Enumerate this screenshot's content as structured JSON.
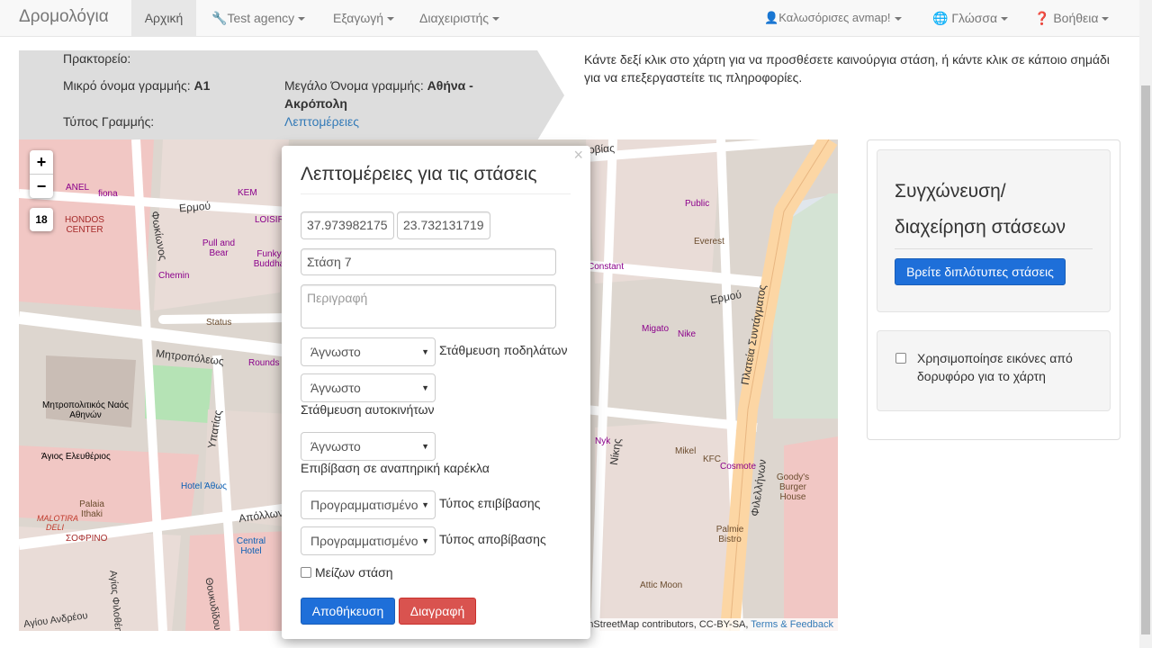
{
  "navbar": {
    "brand": "Δρομολόγια",
    "home": "Αρχική",
    "agency": "Test agency",
    "export": "Εξαγωγή",
    "admin": "Διαχειριστής",
    "user": "Καλωσόρισες avmap!",
    "language": "Γλώσσα",
    "help": "Βοήθεια"
  },
  "route_info": {
    "agency_label": "Πρακτορείο:",
    "short_name_label": "Μικρό όνομα γραμμής:",
    "short_name_value": "A1",
    "long_name_label": "Μεγάλο Όνομα γραμμής:",
    "long_name_value_1": "Αθήνα -",
    "long_name_value_2": "Ακρόπολη",
    "type_label": "Τύπος Γραμμής:",
    "details_link": "Λεπτομέρειες"
  },
  "hint": {
    "line1": "Κάντε δεξί κλικ στο χάρτη για να προσθέσετε καινούργια στάση, ή κάντε κλικ σε κάποιο σημάδι",
    "line2": "για να επεξεργαστείτε τις πληροφορίες."
  },
  "map": {
    "zoom_in": "+",
    "zoom_out": "−",
    "zoom_level": "18",
    "attribution_text": "© OpenStreetMap contributors, CC-BY-SA,",
    "attribution_link": "Terms & Feedback",
    "streets": {
      "ermou": "Ερμού",
      "mitropoleos": "Μητροπόλεως",
      "apollonos": "Απόλλωνος",
      "fokionos": "Φωκίωνος",
      "ypatias": "Υπατίας",
      "syntagmatos": "Πλατεία Συντάγματος",
      "filellinon": "Φιλελλήνων",
      "nikis": "Νίκης",
      "servias": "Σερβίας",
      "ag_filotheis": "Αγίας Φιλοθέης",
      "ag_andreou": "Αγίου Ανδρέου",
      "thoukididou": "Θουκυδίδου"
    },
    "pois": {
      "cathedral": "Μητροπολιτικός Ναός Αθηνών",
      "ag_eleftherios": "Άγιος Ελευθέριος",
      "hondos": "HONDOS CENTER",
      "public": "Public",
      "everest": "Everest",
      "migato": "Migato",
      "nike": "Nike",
      "mikel": "Mikel",
      "kfc": "KFC",
      "cosmote": "Cosmote",
      "goodys": "Goody's Burger House",
      "attic_moon": "Attic Moon",
      "palmie": "Palmie Bistro",
      "central_hotel": "Central Hotel",
      "hotel_athos": "Hotel Άθως",
      "sofrino": "ΣΟΦΡΙΝΟ",
      "malotira": "MALOTIRA DELI",
      "palaia": "Palaia Ithaki",
      "pull_bear": "Pull and Bear",
      "funky": "Funky Buddha",
      "chemin": "Chemin",
      "status": "Status",
      "fiona": "fiona",
      "anel": "ANEL",
      "kem": "KEM",
      "loisir": "LOISIR",
      "rounds": "Rounds",
      "nyk": "Nyk",
      "constant": "Constant"
    }
  },
  "stop_popup": {
    "close": "×",
    "title": "Λεπτομέρειες για τις στάσεις",
    "lat": "37.973982175",
    "lon": "23.732131719",
    "name": "Στάση 7",
    "description_placeholder": "Περιγραφή",
    "bike_value": "Άγνωστο",
    "bike_label": "Στάθμευση ποδηλάτων",
    "car_value": "Άγνωστο",
    "car_label": "Στάθμευση αυτοκινήτων",
    "wheelchair_value": "Άγνωστο",
    "wheelchair_label": "Επιβίβαση σε αναπηρική καρέκλα",
    "pickup_value": "Προγραμματισμένο",
    "pickup_label": "Τύπος επιβίβασης",
    "dropoff_value": "Προγραμματισμένο",
    "dropoff_label": "Τύπος αποβίβασης",
    "major_label": "Μείζων στάση",
    "save": "Αποθήκευση",
    "delete": "Διαγραφή"
  },
  "side": {
    "merge_title_1": "Συγχώνευση/",
    "merge_title_2": "διαχείρηση στάσεων",
    "find_duplicates": "Βρείτε διπλότυπες στάσεις",
    "satellite_label": "Χρησιμοποίησε εικόνες από δορυφόρο για το χάρτη"
  }
}
